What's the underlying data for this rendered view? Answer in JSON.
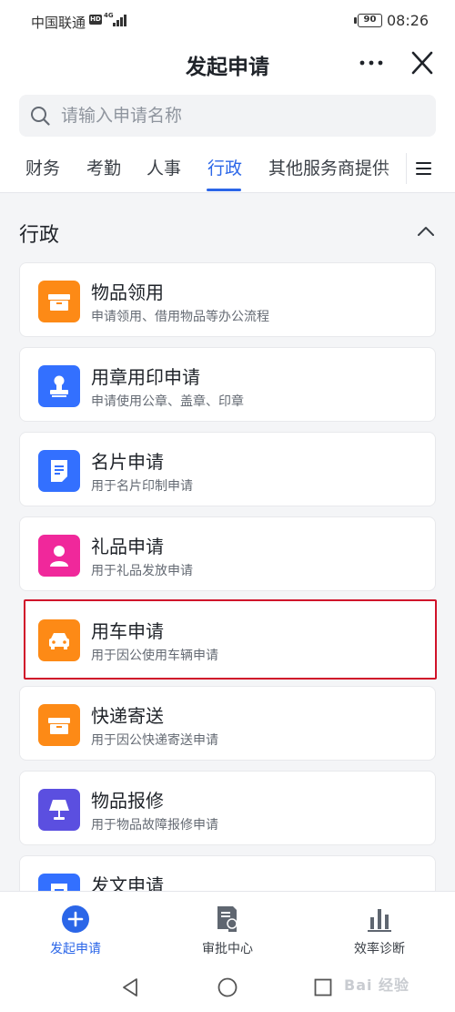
{
  "status_bar": {
    "carrier": "中国联通",
    "hd": "HD",
    "network": "4G",
    "battery": "90",
    "time": "08:26"
  },
  "header": {
    "title": "发起申请",
    "more_icon": "more-horizontal-icon",
    "close_icon": "close-icon"
  },
  "search": {
    "placeholder": "请输入申请名称",
    "value": ""
  },
  "tabs": [
    {
      "label": "财务",
      "active": false
    },
    {
      "label": "考勤",
      "active": false
    },
    {
      "label": "人事",
      "active": false
    },
    {
      "label": "行政",
      "active": true
    },
    {
      "label": "其他服务商提供",
      "active": false
    }
  ],
  "section": {
    "title": "行政"
  },
  "items": [
    {
      "title": "物品领用",
      "desc": "申请领用、借用物品等办公流程",
      "icon": "box-icon",
      "color": "#fd8a16"
    },
    {
      "title": "用章用印申请",
      "desc": "申请使用公章、盖章、印章",
      "icon": "stamp-icon",
      "color": "#3370ff"
    },
    {
      "title": "名片申请",
      "desc": "用于名片印制申请",
      "icon": "document-icon",
      "color": "#3370ff"
    },
    {
      "title": "礼品申请",
      "desc": "用于礼品发放申请",
      "icon": "person-icon",
      "color": "#f0289b"
    },
    {
      "title": "用车申请",
      "desc": "用于因公使用车辆申请",
      "icon": "car-icon",
      "color": "#fd8a16",
      "highlighted": true
    },
    {
      "title": "快递寄送",
      "desc": "用于因公快递寄送申请",
      "icon": "box-icon",
      "color": "#fd8a16"
    },
    {
      "title": "物品报修",
      "desc": "用于物品故障报修申请",
      "icon": "lamp-icon",
      "color": "#5b4fe0"
    },
    {
      "title": "发文申请",
      "desc": "",
      "icon": "document-icon",
      "color": "#3370ff"
    }
  ],
  "bottom_nav": [
    {
      "label": "发起申请",
      "icon": "plus-circle-icon",
      "active": true
    },
    {
      "label": "审批中心",
      "icon": "approval-icon",
      "active": false
    },
    {
      "label": "效率诊断",
      "icon": "bar-chart-icon",
      "active": false
    }
  ],
  "watermark": "Bai 经验",
  "colors": {
    "accent": "#2b66e8",
    "highlight_border": "#d0122a"
  }
}
